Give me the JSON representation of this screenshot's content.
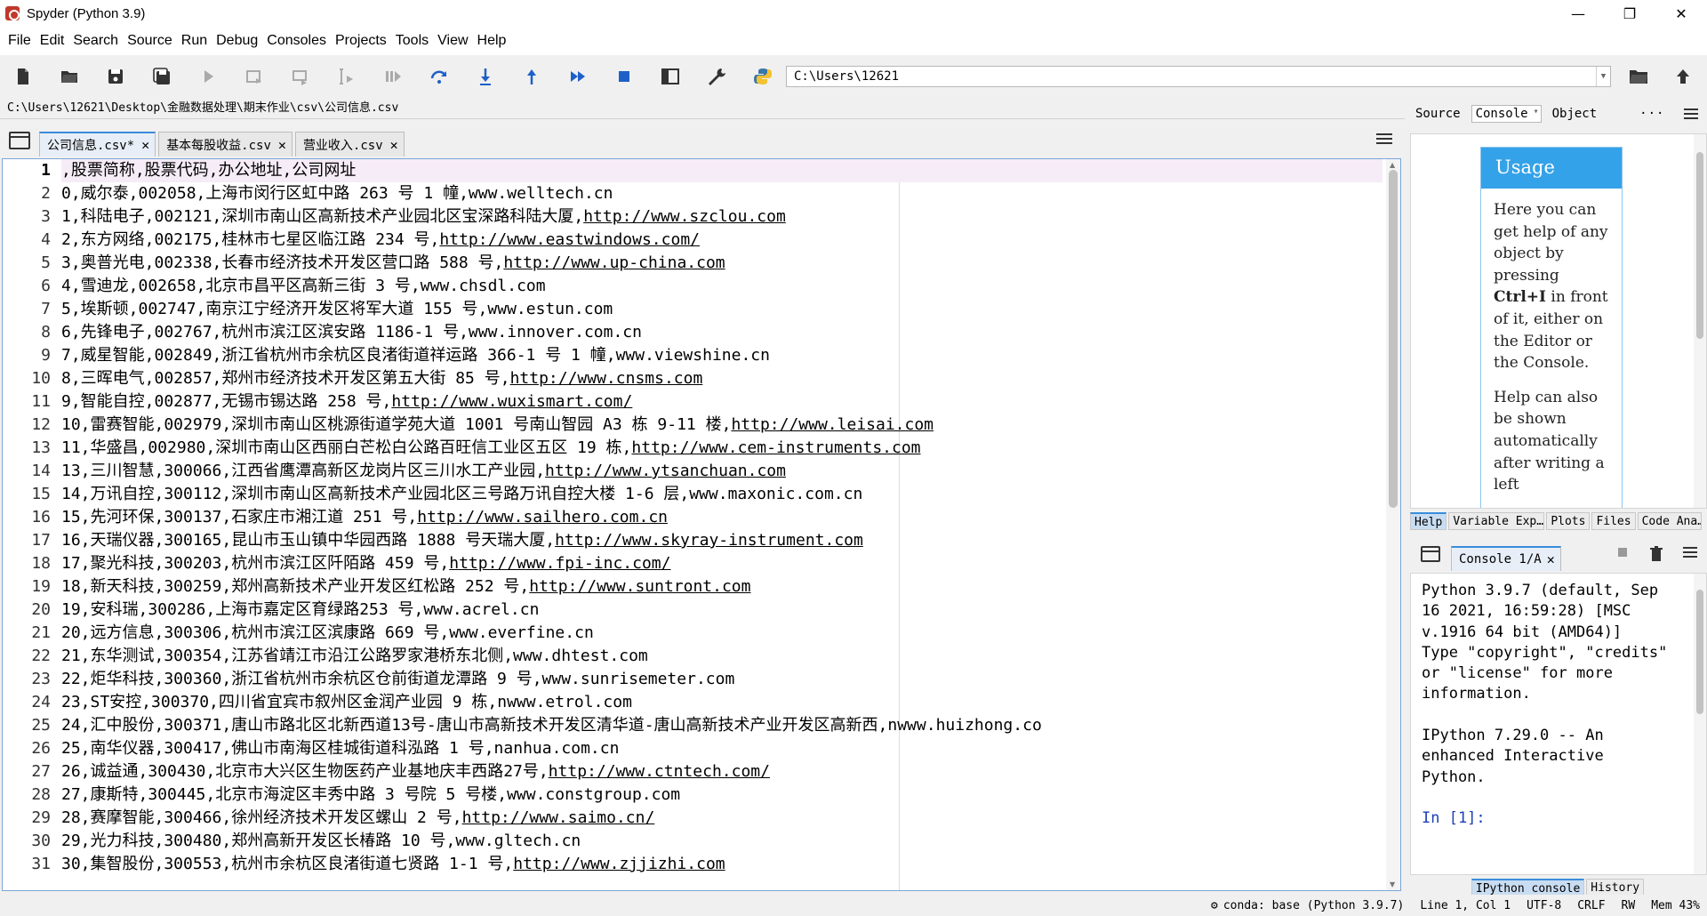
{
  "window": {
    "title": "Spyder (Python 3.9)",
    "min": "—",
    "max": "❐",
    "close": "✕"
  },
  "menu": [
    "File",
    "Edit",
    "Search",
    "Source",
    "Run",
    "Debug",
    "Consoles",
    "Projects",
    "Tools",
    "View",
    "Help"
  ],
  "toolbar": {
    "working_dir": "C:\\Users\\12621"
  },
  "editor": {
    "file_path": "C:\\Users\\12621\\Desktop\\金融数据处理\\期末作业\\csv\\公司信息.csv",
    "tabs": [
      {
        "label": "公司信息.csv*",
        "close": "✕"
      },
      {
        "label": "基本每股收益.csv",
        "close": "✕"
      },
      {
        "label": "营业收入.csv",
        "close": "✕"
      }
    ],
    "lines": [
      {
        "n": "1",
        "text": ",股票简称,股票代码,办公地址,公司网址",
        "url": ""
      },
      {
        "n": "2",
        "text": "0,威尔泰,002058,上海市闵行区虹中路 263 号 1 幢,www.welltech.cn",
        "url": ""
      },
      {
        "n": "3",
        "text": "1,科陆电子,002121,深圳市南山区高新技术产业园北区宝深路科陆大厦,",
        "url": "http://www.szclou.com"
      },
      {
        "n": "4",
        "text": "2,东方网络,002175,桂林市七星区临江路 234 号,",
        "url": "http://www.eastwindows.com/"
      },
      {
        "n": "5",
        "text": "3,奥普光电,002338,长春市经济技术开发区营口路 588 号,",
        "url": "http://www.up-china.com"
      },
      {
        "n": "6",
        "text": "4,雪迪龙,002658,北京市昌平区高新三街 3 号,www.chsdl.com",
        "url": ""
      },
      {
        "n": "7",
        "text": "5,埃斯顿,002747,南京江宁经济开发区将军大道 155 号,www.estun.com",
        "url": ""
      },
      {
        "n": "8",
        "text": "6,先锋电子,002767,杭州市滨江区滨安路 1186-1 号,www.innover.com.cn",
        "url": ""
      },
      {
        "n": "9",
        "text": "7,威星智能,002849,浙江省杭州市余杭区良渚街道祥运路 366-1 号 1 幢,www.viewshine.cn",
        "url": ""
      },
      {
        "n": "10",
        "text": "8,三晖电气,002857,郑州市经济技术开发区第五大街 85 号,",
        "url": "http://www.cnsms.com"
      },
      {
        "n": "11",
        "text": "9,智能自控,002877,无锡市锡达路 258 号,",
        "url": "http://www.wuxismart.com/"
      },
      {
        "n": "12",
        "text": "10,雷赛智能,002979,深圳市南山区桃源街道学苑大道 1001 号南山智园 A3 栋 9-11 楼,",
        "url": "http://www.leisai.com"
      },
      {
        "n": "13",
        "text": "11,华盛昌,002980,深圳市南山区西丽白芒松白公路百旺信工业区五区 19 栋,",
        "url": "http://www.cem-instruments.com"
      },
      {
        "n": "14",
        "text": "13,三川智慧,300066,江西省鹰潭高新区龙岗片区三川水工产业园,",
        "url": "http://www.ytsanchuan.com"
      },
      {
        "n": "15",
        "text": "14,万讯自控,300112,深圳市南山区高新技术产业园北区三号路万讯自控大楼 1-6 层,www.maxonic.com.cn",
        "url": ""
      },
      {
        "n": "16",
        "text": "15,先河环保,300137,石家庄市湘江道 251 号,",
        "url": "http://www.sailhero.com.cn"
      },
      {
        "n": "17",
        "text": "16,天瑞仪器,300165,昆山市玉山镇中华园西路 1888 号天瑞大厦,",
        "url": "http://www.skyray-instrument.com"
      },
      {
        "n": "18",
        "text": "17,聚光科技,300203,杭州市滨江区阡陌路 459 号,",
        "url": "http://www.fpi-inc.com/"
      },
      {
        "n": "19",
        "text": "18,新天科技,300259,郑州高新技术产业开发区红松路 252 号,",
        "url": "http://www.suntront.com"
      },
      {
        "n": "20",
        "text": "19,安科瑞,300286,上海市嘉定区育绿路253 号,www.acrel.cn",
        "url": ""
      },
      {
        "n": "21",
        "text": "20,远方信息,300306,杭州市滨江区滨康路 669 号,www.everfine.cn",
        "url": ""
      },
      {
        "n": "22",
        "text": "21,东华测试,300354,江苏省靖江市沿江公路罗家港桥东北侧,www.dhtest.com",
        "url": ""
      },
      {
        "n": "23",
        "text": "22,炬华科技,300360,浙江省杭州市余杭区仓前街道龙潭路 9 号,www.sunrisemeter.com",
        "url": ""
      },
      {
        "n": "24",
        "text": "23,ST安控,300370,四川省宜宾市叙州区金润产业园 9 栋,nwww.etrol.com",
        "url": ""
      },
      {
        "n": "25",
        "text": "24,汇中股份,300371,唐山市路北区北新西道13号-唐山市高新技术开发区清华道-唐山高新技术产业开发区高新西,nwww.huizhong.co",
        "url": ""
      },
      {
        "n": "26",
        "text": "25,南华仪器,300417,佛山市南海区桂城街道科泓路 1 号,nanhua.com.cn",
        "url": ""
      },
      {
        "n": "27",
        "text": "26,诚益通,300430,北京市大兴区生物医药产业基地庆丰西路27号,",
        "url": "http://www.ctntech.com/"
      },
      {
        "n": "28",
        "text": "27,康斯特,300445,北京市海淀区丰秀中路 3 号院 5 号楼,www.constgroup.com",
        "url": ""
      },
      {
        "n": "29",
        "text": "28,赛摩智能,300466,徐州经济技术开发区螺山 2 号,",
        "url": "http://www.saimo.cn/"
      },
      {
        "n": "30",
        "text": "29,光力科技,300480,郑州高新开发区长椿路 10 号,www.gltech.cn",
        "url": ""
      },
      {
        "n": "31",
        "text": "30,集智股份,300553,杭州市余杭区良渚街道七贤路 1-1 号,",
        "url": "http://www.zjjizhi.com"
      }
    ]
  },
  "help": {
    "source_label": "Source",
    "source_value": "Console",
    "object_label": "Object",
    "more": "···",
    "usage_title": "Usage",
    "usage_p1a": "Here you can get help of any object by pressing ",
    "usage_key": "Ctrl+I",
    "usage_p1b": " in front of it, either on the Editor or the Console.",
    "usage_p2": "Help can also be shown automatically after writing a left",
    "tabs": [
      "Help",
      "Variable Exp…",
      "Plots",
      "Files",
      "Code Ana…"
    ]
  },
  "console": {
    "tab_label": "Console 1/A",
    "tab_close": "✕",
    "banner": "Python 3.9.7 (default, Sep 16 2021, 16:59:28) [MSC v.1916 64 bit (AMD64)]\nType \"copyright\", \"credits\" or \"license\" for more information.\n\nIPython 7.29.0 -- An enhanced Interactive Python.\n\n",
    "prompt": "In [1]:",
    "tabs": [
      "IPython console",
      "History"
    ]
  },
  "status": {
    "conda": "conda: base (Python 3.9.7)",
    "position": "Line 1, Col 1",
    "encoding": "UTF-8",
    "eol": "CRLF",
    "rw": "RW",
    "mem": "Mem 43%"
  }
}
